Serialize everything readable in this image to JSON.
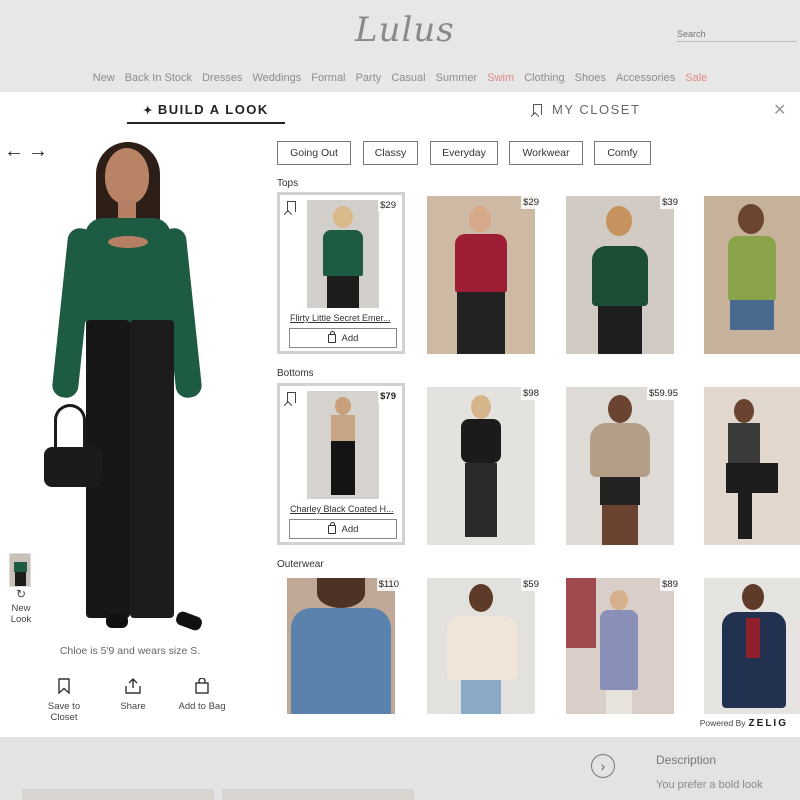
{
  "header": {
    "logo": "Lulus",
    "search_placeholder": "Search",
    "nav": [
      {
        "label": "New",
        "sale": false
      },
      {
        "label": "Back In Stock",
        "sale": false
      },
      {
        "label": "Dresses",
        "sale": false
      },
      {
        "label": "Weddings",
        "sale": false
      },
      {
        "label": "Formal",
        "sale": false
      },
      {
        "label": "Party",
        "sale": false
      },
      {
        "label": "Casual",
        "sale": false
      },
      {
        "label": "Summer",
        "sale": false
      },
      {
        "label": "Swim",
        "sale": true
      },
      {
        "label": "Clothing",
        "sale": false
      },
      {
        "label": "Shoes",
        "sale": false
      },
      {
        "label": "Accessories",
        "sale": false
      },
      {
        "label": "Sale",
        "sale": true
      }
    ]
  },
  "modal": {
    "tab_build": "BUILD A LOOK",
    "tab_closet": "MY CLOSET",
    "close_icon": "close-icon",
    "prev_icon": "arrow-left-icon",
    "next_icon": "arrow-right-icon",
    "new_look": "New Look",
    "model_caption": "Chloe is 5'9 and wears size S.",
    "actions": {
      "save": "Save to Closet",
      "share": "Share",
      "bag": "Add to Bag"
    },
    "filters": [
      "Going Out",
      "Classy",
      "Everyday",
      "Workwear",
      "Comfy"
    ],
    "sections": {
      "tops": {
        "title": "Tops",
        "items": [
          {
            "price": "$29",
            "name": "Flirty Little Secret Emer...",
            "add": "Add"
          },
          {
            "price": "$29"
          },
          {
            "price": "$39"
          },
          {
            "price": ""
          }
        ]
      },
      "bottoms": {
        "title": "Bottoms",
        "items": [
          {
            "price": "$79",
            "name": "Charley Black Coated H...",
            "add": "Add"
          },
          {
            "price": "$98"
          },
          {
            "price": "$59.95"
          },
          {
            "price": ""
          }
        ]
      },
      "outerwear": {
        "title": "Outerwear",
        "items": [
          {
            "price": "$110"
          },
          {
            "price": "$59"
          },
          {
            "price": "$89"
          },
          {
            "price": ""
          }
        ]
      }
    },
    "powered_by": "Powered By",
    "powered_brand": "ZELIG"
  },
  "page_below": {
    "description_title": "Description",
    "description_text": "You prefer a bold look"
  },
  "colors": {
    "accent_sale": "#e08a85",
    "top_green": "#1e5b43",
    "jeans_black": "#171717"
  }
}
